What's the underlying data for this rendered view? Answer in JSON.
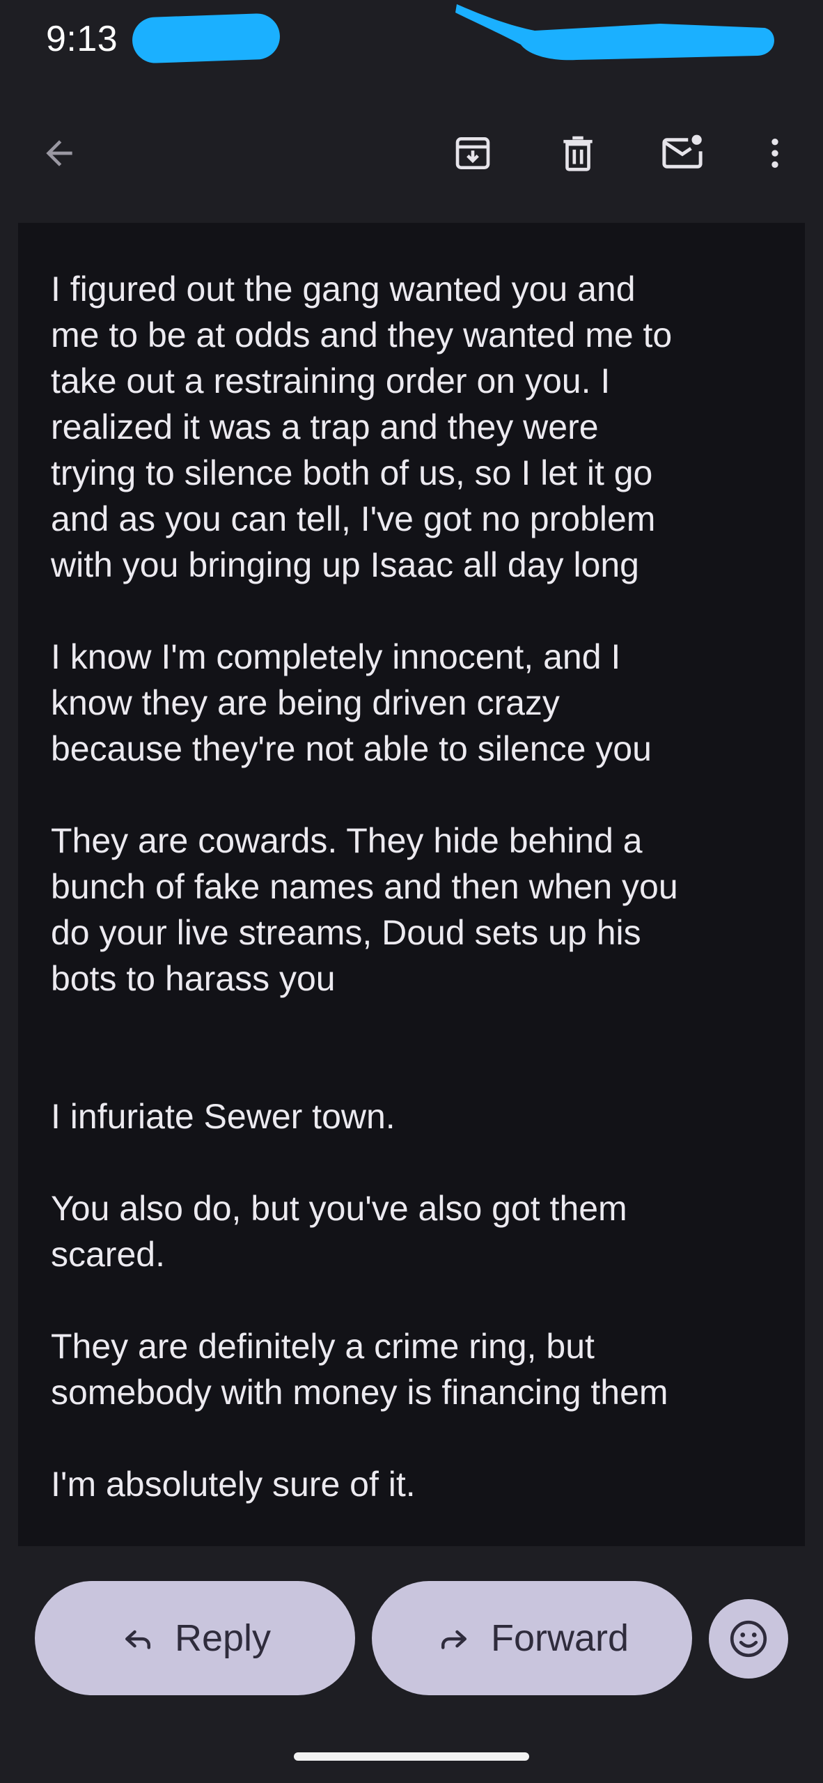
{
  "status_bar": {
    "time": "9:13",
    "redaction_color": "#1bb0ff"
  },
  "app_bar": {
    "back_icon": "arrow-back-icon",
    "archive_icon": "archive-icon",
    "delete_icon": "trash-icon",
    "mark_unread_icon": "mail-unread-icon",
    "more_icon": "more-vert-icon"
  },
  "email": {
    "partial_top_line": "· · · · ·",
    "paragraphs": [
      "I figured out the gang wanted you and\nme to be at odds and they wanted me to\ntake out a restraining order on you. I\nrealized it was a trap and they were\ntrying to silence both of us, so I let it go\nand as you can tell, I've got no problem\nwith you bringing up Isaac all day long",
      "I know I'm completely innocent, and I\nknow they are being driven crazy\nbecause they're not able to silence you",
      "They are cowards. They hide behind a\nbunch of fake names and then when you\ndo your live streams, Doud sets up his\nbots to harass you",
      "I infuriate Sewer town.",
      "You also do, but you've also got them\nscared.",
      "They are definitely a crime ring, but\nsomebody with money is financing them",
      "I'm absolutely sure of it."
    ]
  },
  "actions": {
    "reply_label": "Reply",
    "forward_label": "Forward",
    "reply_icon": "reply-icon",
    "forward_icon": "forward-icon",
    "emoji_icon": "emoji-smile-icon"
  },
  "colors": {
    "background": "#1e1e23",
    "body_card": "#121217",
    "pill": "#c9c5dd",
    "pill_text": "#2f2c3c",
    "text": "#eceaf0"
  }
}
